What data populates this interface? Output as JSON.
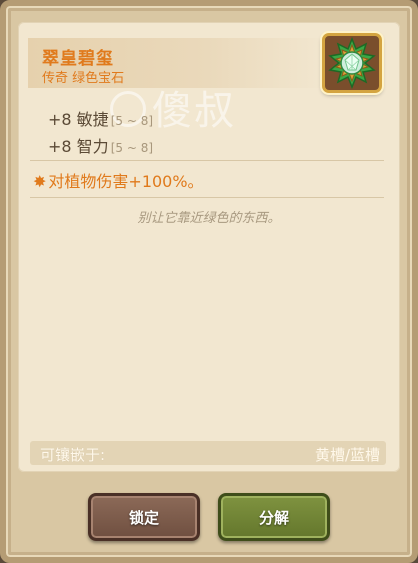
{
  "item": {
    "name": "翠皇碧玺",
    "type": "传奇 绿色宝石",
    "icon": "green-gem-icon"
  },
  "watermark": "傻叔",
  "stats": [
    {
      "label": "+8 敏捷",
      "range": "[5 ~ 8]"
    },
    {
      "label": "+8 智力",
      "range": "[5 ~ 8]"
    }
  ],
  "effect": {
    "star": "✸",
    "text": "对植物伤害+100%。"
  },
  "flavor": "别让它靠近绿色的东西。",
  "socket": {
    "label": "可镶嵌于:",
    "value": "黄槽/蓝槽"
  },
  "buttons": {
    "lock": "锁定",
    "decompose": "分解"
  },
  "colors": {
    "legendary_orange": "#e07a1c",
    "gem_green": "#3aa845",
    "lock_button": "#7a5a4a",
    "decompose_button": "#6f8436"
  }
}
